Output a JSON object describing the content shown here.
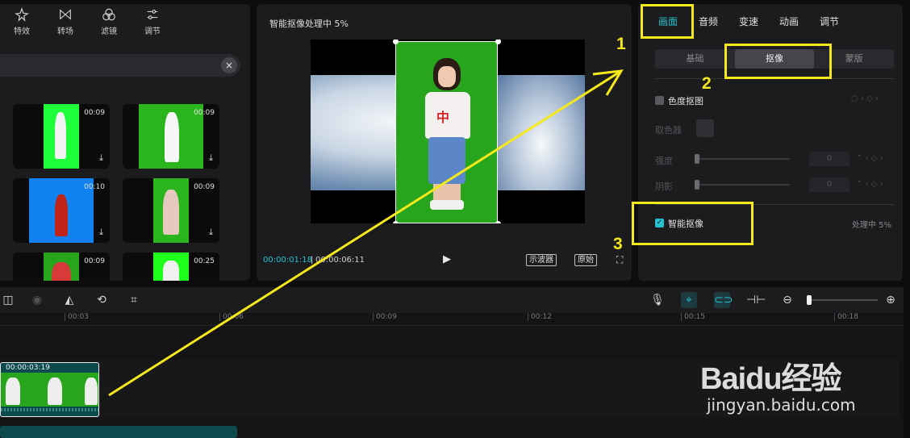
{
  "left_panel": {
    "tabs": [
      {
        "label": "特效",
        "icon": "star-sparkle-icon"
      },
      {
        "label": "转场",
        "icon": "bowtie-transition-icon"
      },
      {
        "label": "滤镜",
        "icon": "filter-circles-icon"
      },
      {
        "label": "调节",
        "icon": "sliders-icon"
      }
    ],
    "search_clear": "×",
    "thumbnails": [
      {
        "duration": "00:09",
        "bg": "#1eff3a"
      },
      {
        "duration": "00:09",
        "bg": "#2bb51c"
      },
      {
        "duration": "00:10",
        "bg": "#1282f0"
      },
      {
        "duration": "00:09",
        "bg": "#2bb51c"
      },
      {
        "duration": "00:09",
        "bg": "#27a51c"
      },
      {
        "duration": "00:25",
        "bg": "#1eff1e"
      }
    ],
    "download_glyph": "⤓"
  },
  "player": {
    "title": "智能抠像处理中 5%",
    "current_time": "00:00:01:18",
    "separator": "|",
    "total_time": "00:00:06:11",
    "play_glyph": "▶",
    "scope_button": "示波器",
    "original_button": "原始",
    "fullscreen_glyph": "⛶"
  },
  "inspector": {
    "tabs": [
      "画面",
      "音频",
      "变速",
      "动画",
      "调节"
    ],
    "active_tab": "画面",
    "subtabs": [
      "基础",
      "抠像",
      "蒙版"
    ],
    "active_subtab": "抠像",
    "chroma_key_label": "色度抠图",
    "chroma_key_checked": false,
    "color_picker_label": "取色器",
    "intensity_label": "强度",
    "shadow_label": "阴影",
    "intensity_value": "0",
    "shadow_value": "0",
    "smart_cutout_label": "智能抠像",
    "smart_cutout_checked": true,
    "processing_status": "处理中 5%",
    "accent": "#24c2cf"
  },
  "timeline": {
    "ticks": [
      "00:03",
      "00:06",
      "00:09",
      "00:12",
      "00:15",
      "00:18"
    ],
    "clip_duration": "00:00:03:19"
  },
  "annotations": {
    "numbers": [
      "1",
      "2",
      "3"
    ],
    "color": "#f5e81c"
  },
  "watermark": {
    "logo": "Baidu经验",
    "url": "jingyan.baidu.com"
  }
}
